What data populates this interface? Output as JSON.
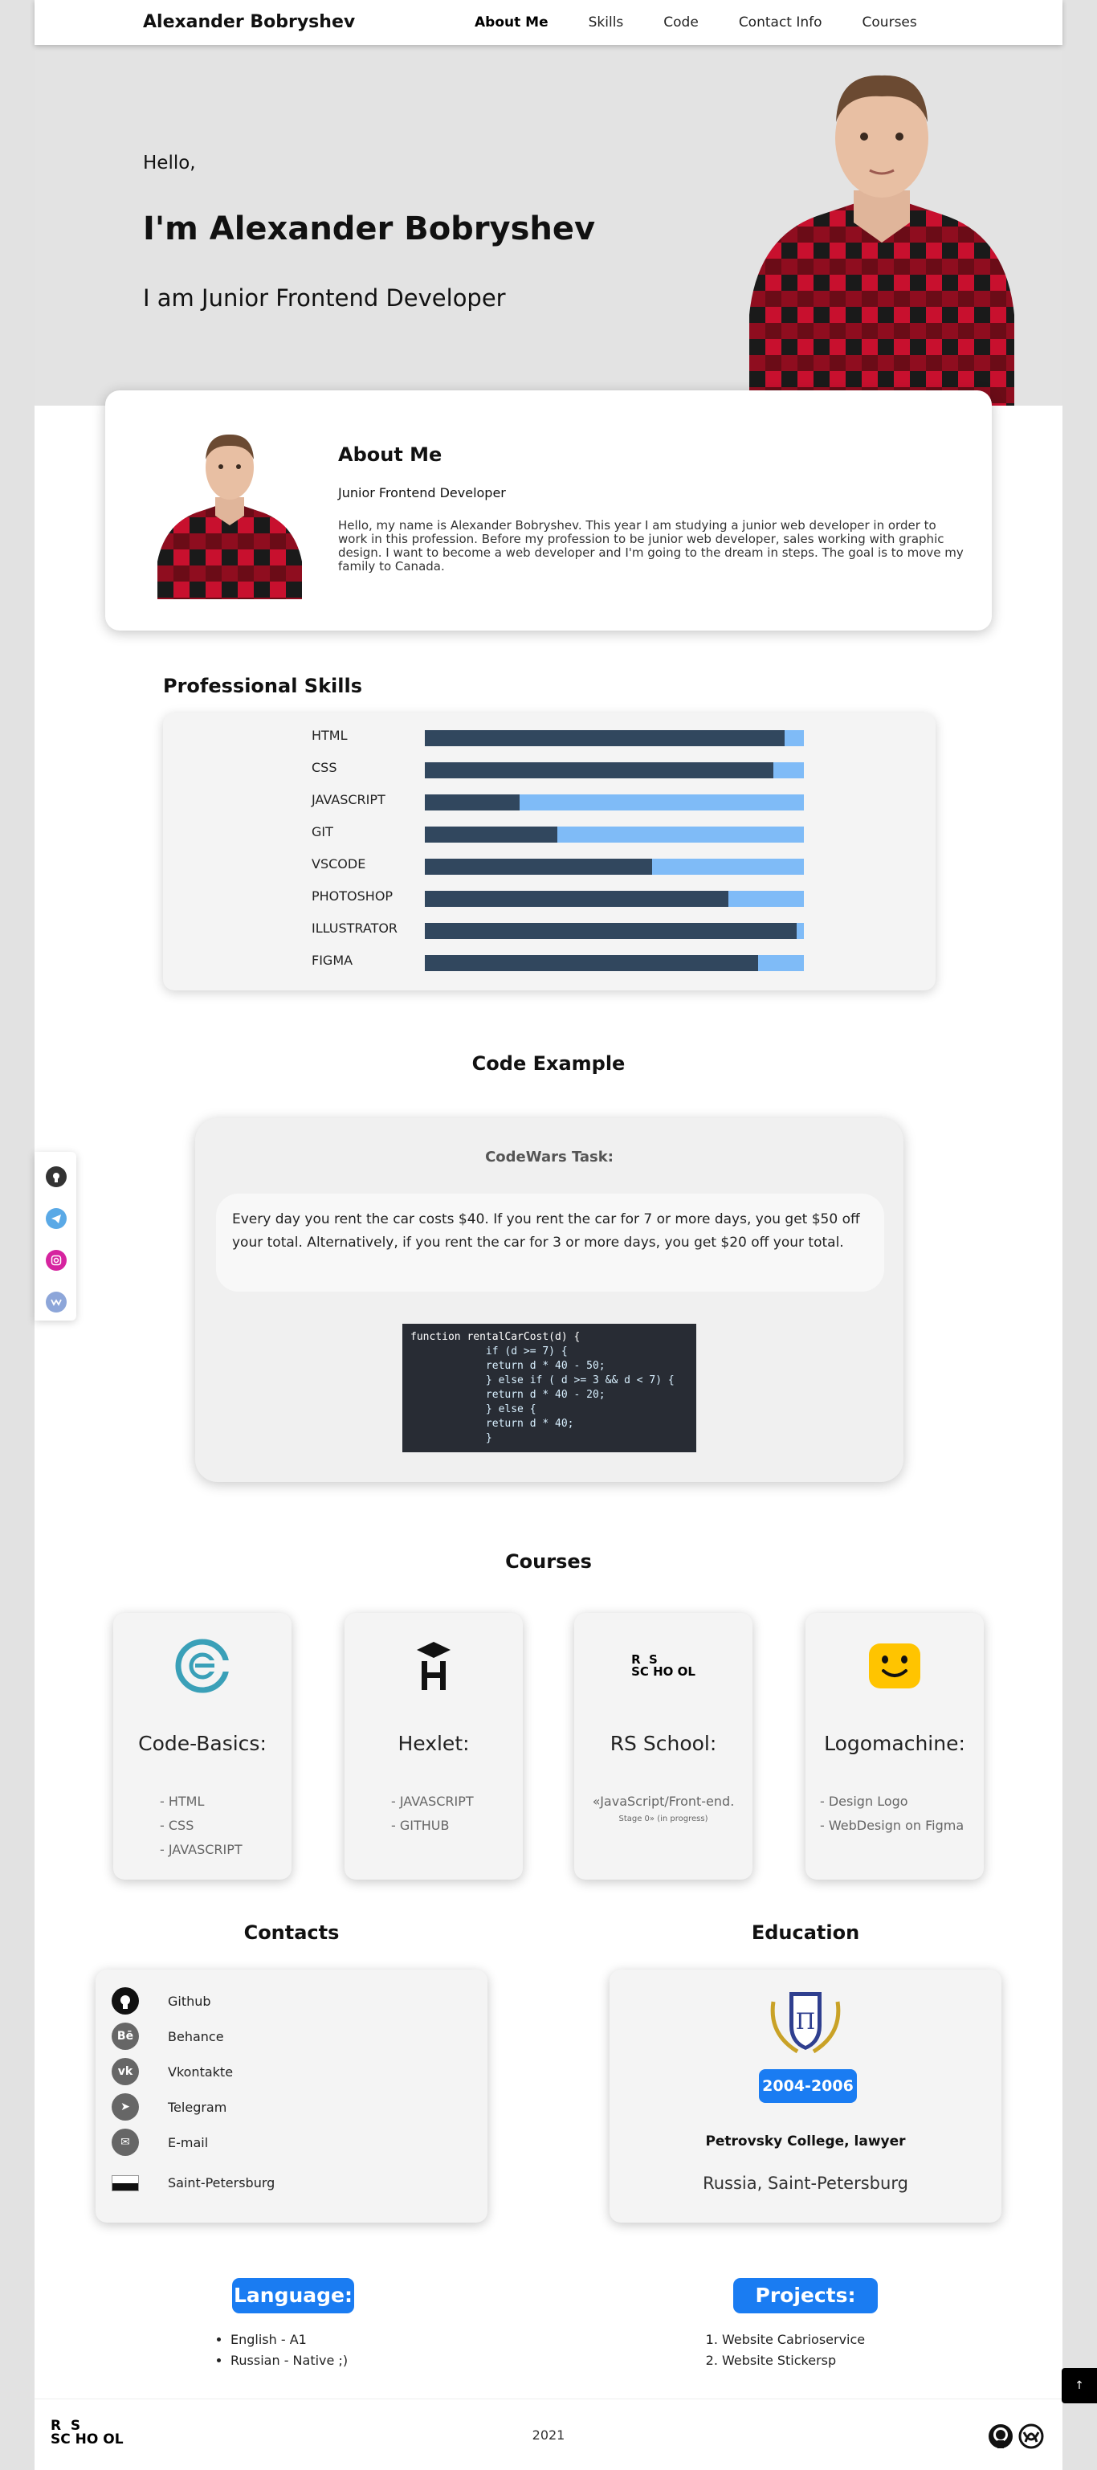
{
  "header": {
    "brand": "Alexander Bobryshev",
    "nav": [
      {
        "label": "About Me",
        "active": true
      },
      {
        "label": "Skills",
        "active": false
      },
      {
        "label": "Code",
        "active": false
      },
      {
        "label": "Contact Info",
        "active": false
      },
      {
        "label": "Courses",
        "active": false
      }
    ]
  },
  "hero": {
    "greeting": "Hello,",
    "name": "I'm Alexander Bobryshev",
    "role": "I am Junior Frontend Developer"
  },
  "about": {
    "title": "About Me",
    "subtitle": "Junior Frontend Developer",
    "text": "Hello, my name is Alexander Bobryshev. This year I am studying a junior web developer in order to work in this profession. Before my profession to be junior web developer, sales working with graphic design. I want to become a web developer and I'm going to the dream in steps. The goal is to move my family to Canada."
  },
  "skills": {
    "title": "Professional Skills",
    "items": [
      {
        "label": "HTML",
        "level": 0.95
      },
      {
        "label": "CSS",
        "level": 0.92
      },
      {
        "label": "JAVASCRIPT",
        "level": 0.25
      },
      {
        "label": "GIT",
        "level": 0.35
      },
      {
        "label": "VSCODE",
        "level": 0.6
      },
      {
        "label": "PHOTOSHOP",
        "level": 0.8
      },
      {
        "label": "ILLUSTRATOR",
        "level": 0.98
      },
      {
        "label": "FIGMA",
        "level": 0.88
      }
    ]
  },
  "code": {
    "title": "Code Example",
    "task_title": "CodeWars Task:",
    "description": "Every day you rent the car costs $40. If you rent the car for 7 or more days, you get $50 off your total. Alternatively, if you rent the car for 3 or more days, you get $20 off your total.",
    "lines": [
      "function rentalCarCost(d) {",
      "            if (d >= 7) {",
      "            return d * 40 - 50;",
      "            } else if ( d >= 3 && d < 7) {",
      "            return d * 40 - 20;",
      "            } else {",
      "            return d * 40;",
      "            }"
    ]
  },
  "courses": {
    "title": "Courses",
    "items": [
      {
        "name": "Code-Basics:",
        "icon": "code-basics-logo",
        "list": [
          "- HTML",
          "- CSS",
          "- JAVASCRIPT"
        ]
      },
      {
        "name": "Hexlet:",
        "icon": "hexlet-logo",
        "list": [
          "- JAVASCRIPT",
          "- GITHUB"
        ]
      },
      {
        "name": "RS School:",
        "icon": "rs-school-logo",
        "list": [
          "«JavaScript/Front-end.",
          "Stage 0» (in progress)"
        ]
      },
      {
        "name": "Logomachine:",
        "icon": "logomachine-logo",
        "list": [
          "- Design Logo",
          "- WebDesign on Figma"
        ]
      }
    ],
    "rs_logo_top": "R  S",
    "rs_logo_bottom": "SC HO OL"
  },
  "contacts": {
    "title": "Contacts",
    "items": [
      {
        "label": "Github",
        "icon": "github-icon",
        "badge": "●"
      },
      {
        "label": "Behance",
        "icon": "behance-icon",
        "badge": "Bē"
      },
      {
        "label": "Vkontakte",
        "icon": "vk-icon",
        "badge": "vk"
      },
      {
        "label": "Telegram",
        "icon": "telegram-icon",
        "badge": "➤"
      },
      {
        "label": "E-mail",
        "icon": "email-icon",
        "badge": "✉"
      },
      {
        "label": "Saint-Petersburg",
        "icon": "flag-icon",
        "badge": ""
      }
    ]
  },
  "education": {
    "title": "Education",
    "years": "2004-2006",
    "college": "Petrovsky College, lawyer",
    "place": "Russia, Saint-Petersburg",
    "crest_letter": "П"
  },
  "language": {
    "title": "Language:",
    "items": [
      "English - A1",
      "Russian - Native ;)"
    ]
  },
  "projects": {
    "title": "Projects:",
    "items": [
      "Website Cabrioservice",
      "Website Stickersp"
    ]
  },
  "footer": {
    "year": "2021",
    "scroll_top": "↑"
  },
  "side_social": {
    "items": [
      {
        "icon": "github-icon",
        "color": "#333333"
      },
      {
        "icon": "telegram-icon",
        "color": "#5aa9e6"
      },
      {
        "icon": "instagram-icon",
        "color": "#d6249f"
      },
      {
        "icon": "vk-icon",
        "color": "#8da6d9"
      }
    ]
  },
  "colors": {
    "accent": "#1a7cf2",
    "skill_fill": "#31475e",
    "skill_track": "#7fbbf7"
  }
}
